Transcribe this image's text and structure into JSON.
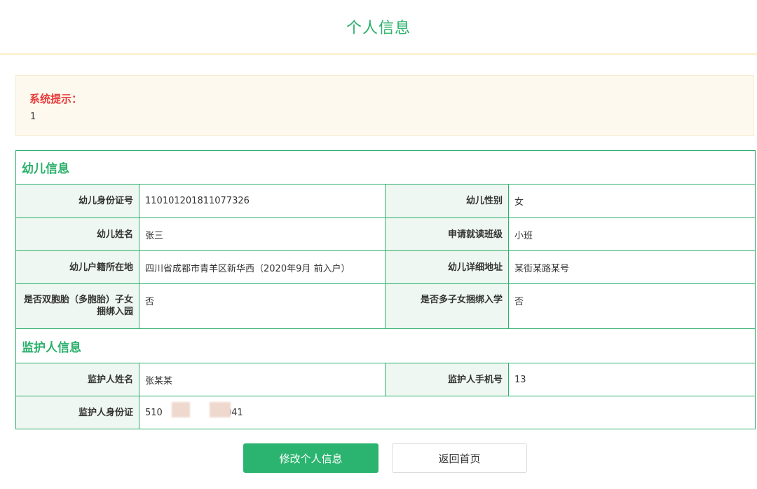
{
  "header": {
    "title": "个人信息"
  },
  "notice": {
    "label": "系统提示：",
    "text": "1"
  },
  "child_section": {
    "title": "幼儿信息",
    "rows": [
      {
        "l1": "幼儿身份证号",
        "v1": "110101201811077326",
        "l2": "幼儿性别",
        "v2": "女"
      },
      {
        "l1": "幼儿姓名",
        "v1": "张三",
        "l2": "申请就读班级",
        "v2": "小班"
      },
      {
        "l1": "幼儿户籍所在地",
        "v1": "四川省成都市青羊区新华西（2020年9月 前入户）",
        "l2": "幼儿详细地址",
        "v2": "某街某路某号"
      },
      {
        "l1": "是否双胞胎（多胞胎）子女捆绑入园",
        "v1": "否",
        "l2": "是否多子女捆绑入学",
        "v2": "否"
      }
    ]
  },
  "guardian_section": {
    "title": "监护人信息",
    "rows": [
      {
        "l1": "监护人姓名",
        "v1": "张某某",
        "l2": "监护人手机号",
        "v2": "13"
      },
      {
        "l1": "监护人身份证",
        "v1_prefix": "510",
        "v1_suffix": "041"
      }
    ]
  },
  "buttons": {
    "edit": "修改个人信息",
    "home": "返回首页"
  }
}
